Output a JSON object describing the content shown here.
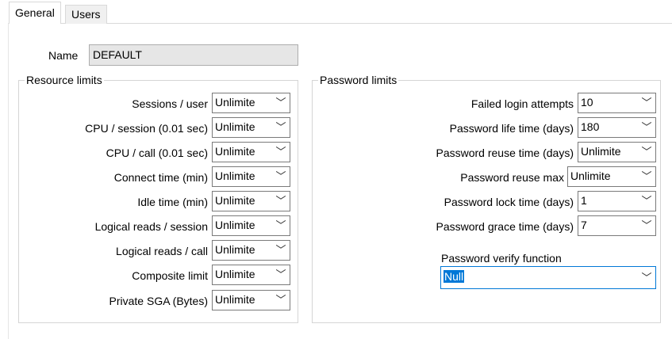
{
  "tabs": [
    {
      "label": "General",
      "active": true
    },
    {
      "label": "Users",
      "active": false
    }
  ],
  "name": {
    "label": "Name",
    "value": "DEFAULT"
  },
  "resource_limits": {
    "title": "Resource limits",
    "rows": [
      {
        "label": "Sessions / user",
        "value": "Unlimite"
      },
      {
        "label": "CPU / session (0.01 sec)",
        "value": "Unlimite"
      },
      {
        "label": "CPU / call (0.01 sec)",
        "value": "Unlimite"
      },
      {
        "label": "Connect time (min)",
        "value": "Unlimite"
      },
      {
        "label": "Idle time (min)",
        "value": "Unlimite"
      },
      {
        "label": "Logical reads / session",
        "value": "Unlimite"
      },
      {
        "label": "Logical reads / call",
        "value": "Unlimite"
      },
      {
        "label": "Composite limit",
        "value": "Unlimite"
      },
      {
        "label": "Private SGA (Bytes)",
        "value": "Unlimite"
      }
    ]
  },
  "password_limits": {
    "title": "Password limits",
    "rows": [
      {
        "label": "Failed login attempts",
        "value": "10"
      },
      {
        "label": "Password life time (days)",
        "value": "180"
      },
      {
        "label": "Password reuse time (days)",
        "value": "Unlimite"
      },
      {
        "label": "Password reuse max",
        "value": "Unlimite"
      },
      {
        "label": "Password lock time (days)",
        "value": "1"
      },
      {
        "label": "Password grace time (days)",
        "value": "7"
      }
    ],
    "verify": {
      "label": "Password verify function",
      "value": "Null"
    }
  },
  "icons": {
    "dropdown": "chevron-down-icon"
  },
  "colors": {
    "selection": "#0078d7",
    "readonly_bg": "#e6e6e6"
  }
}
